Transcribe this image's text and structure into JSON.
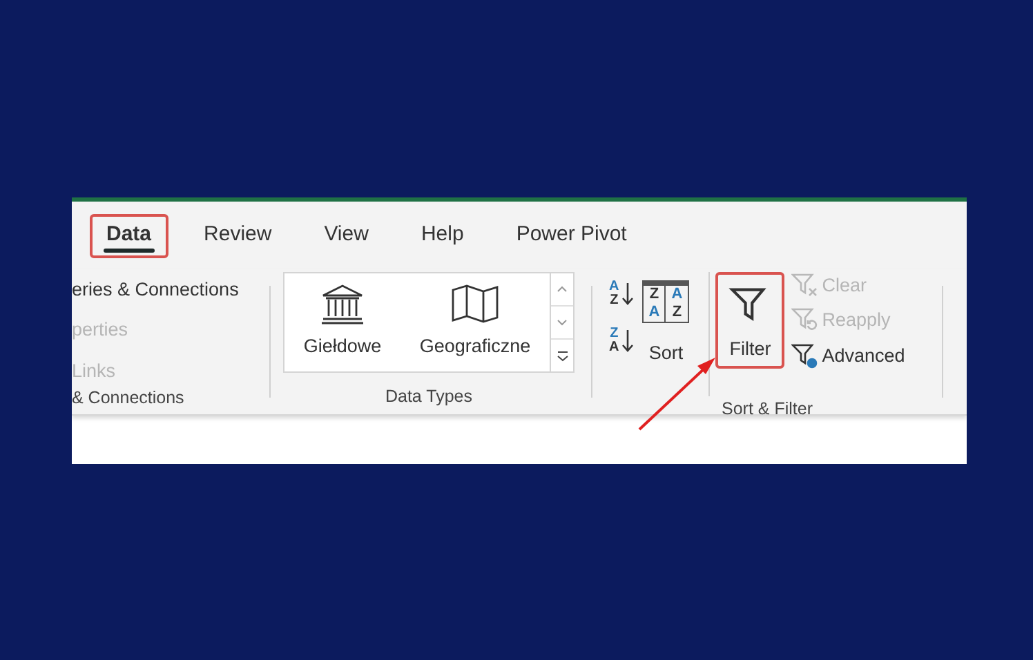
{
  "tabs": [
    {
      "label": "Data",
      "selected": true,
      "highlighted": true
    },
    {
      "label": "Review",
      "selected": false,
      "highlighted": false
    },
    {
      "label": "View",
      "selected": false,
      "highlighted": false
    },
    {
      "label": "Help",
      "selected": false,
      "highlighted": false
    },
    {
      "label": "Power Pivot",
      "selected": false,
      "highlighted": false
    }
  ],
  "queries_group": {
    "items": [
      {
        "label": "eries & Connections",
        "disabled": false
      },
      {
        "label": "perties",
        "disabled": true
      },
      {
        "label": "Links",
        "disabled": true
      }
    ],
    "caption": "& Connections"
  },
  "data_types_group": {
    "items": [
      {
        "kind": "stocks",
        "label": "Giełdowe"
      },
      {
        "kind": "geography",
        "label": "Geograficzne"
      }
    ],
    "caption": "Data Types"
  },
  "sort_filter_group": {
    "sort_icons": [
      {
        "top": "A",
        "bottom": "Z"
      },
      {
        "top": "Z",
        "bottom": "A"
      }
    ],
    "sort_button": {
      "label": "Sort",
      "glyph": [
        [
          "Z",
          "A"
        ],
        [
          "A",
          "Z"
        ]
      ]
    },
    "filter_button": {
      "label": "Filter",
      "highlighted": true
    },
    "actions": [
      {
        "kind": "clear",
        "label": "Clear",
        "disabled": true
      },
      {
        "kind": "reapply",
        "label": "Reapply",
        "disabled": true
      },
      {
        "kind": "advanced",
        "label": "Advanced",
        "disabled": false
      }
    ],
    "caption": "Sort & Filter"
  }
}
